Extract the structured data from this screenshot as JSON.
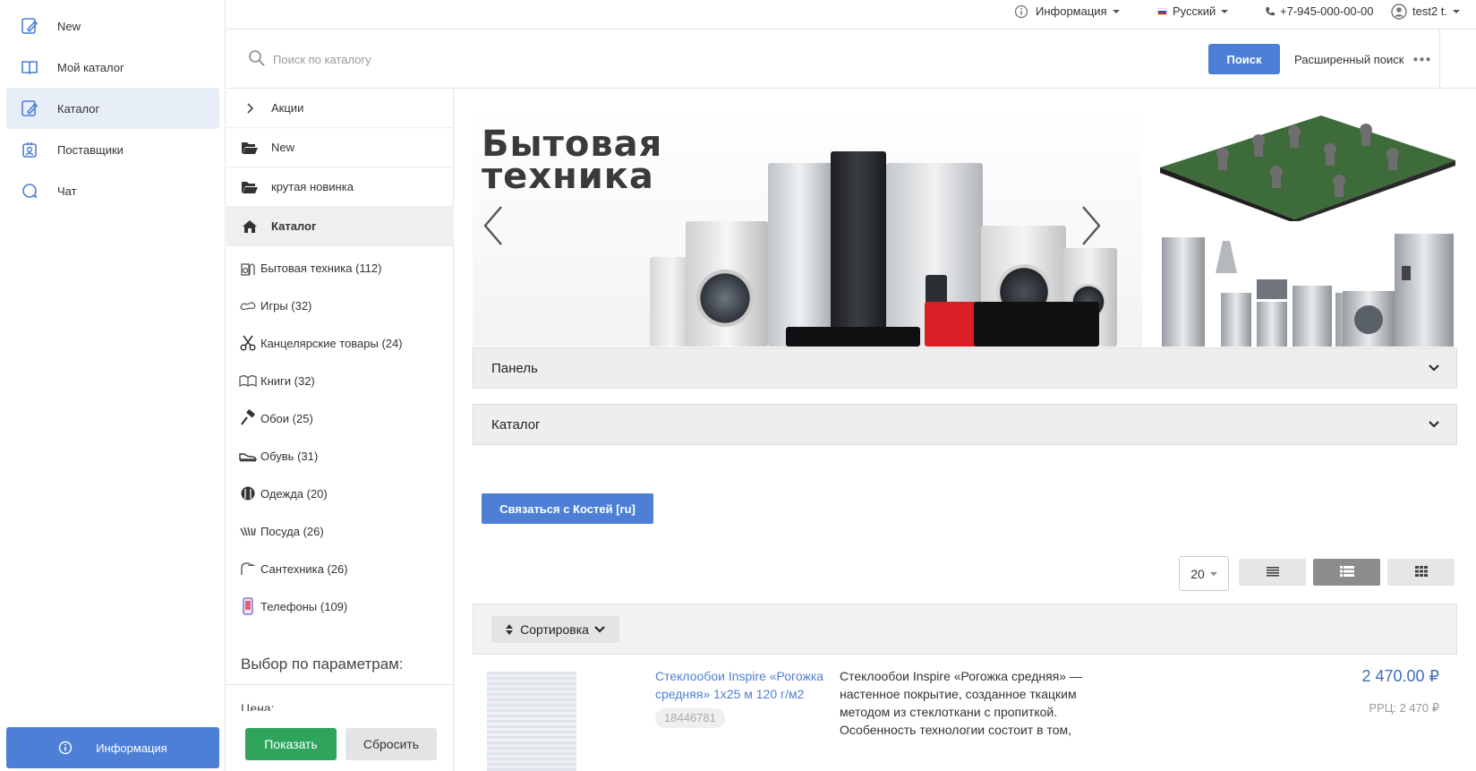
{
  "nav": {
    "items": [
      {
        "label": "New",
        "icon": "catalog-edit-icon"
      },
      {
        "label": "Мой каталог",
        "icon": "book-icon"
      },
      {
        "label": "Каталог",
        "icon": "catalog-edit-icon",
        "active": true
      },
      {
        "label": "Поставщики",
        "icon": "supplier-badge-icon"
      },
      {
        "label": "Чат",
        "icon": "chat-icon"
      }
    ],
    "info_button": "Информация"
  },
  "topbar": {
    "info": "Информация",
    "language": "Русский",
    "phone": "+7-945-000-00-00",
    "user": "test2 t."
  },
  "search": {
    "placeholder": "Поиск по каталогу",
    "button": "Поиск",
    "advanced": "Расширенный поиск"
  },
  "categories": {
    "top_rows": [
      {
        "label": "Акции",
        "icon": "chevron-right-icon"
      },
      {
        "label": "New",
        "icon": "folder-open-icon"
      },
      {
        "label": "крутая новинка",
        "icon": "folder-open-icon"
      },
      {
        "label": "Каталог",
        "icon": "home-icon",
        "active": true
      }
    ],
    "items": [
      {
        "label": "Бытовая техника (112)",
        "icon": "appliance-icon"
      },
      {
        "label": "Игры (32)",
        "icon": "games-icon"
      },
      {
        "label": "Канцелярские товары (24)",
        "icon": "scissors-icon"
      },
      {
        "label": "Книги (32)",
        "icon": "book-open-icon"
      },
      {
        "label": "Обои (25)",
        "icon": "paint-roller-icon"
      },
      {
        "label": "Обувь (31)",
        "icon": "shoe-icon"
      },
      {
        "label": "Одежда (20)",
        "icon": "clothes-icon"
      },
      {
        "label": "Посуда (26)",
        "icon": "dishes-icon"
      },
      {
        "label": "Сантехника (26)",
        "icon": "shower-icon"
      },
      {
        "label": "Телефоны (109)",
        "icon": "phone-icon"
      }
    ],
    "params_title": "Выбор по параметрам:",
    "price_label": "Цена:",
    "show_button": "Показать",
    "reset_button": "Сбросить"
  },
  "banner": {
    "title_line1": "Бытовая",
    "title_line2": "техника"
  },
  "accordions": [
    "Панель",
    "Каталог"
  ],
  "contact_button": "Связаться с Костей [ru]",
  "list_controls": {
    "per_page": "20",
    "sort_label": "Сортировка"
  },
  "product": {
    "title": "Стеклообои Inspire «Рогожка средняя» 1х25 м 120 г/м2",
    "sku": "18446781",
    "description": "Стеклообои Inspire «Рогожка средняя» — настенное покрытие, созданное ткацким методом из стеклоткани с пропиткой. Особенность технологии состоит в том,",
    "price": "2 470.00 ₽",
    "rrp": "РРЦ: 2 470 ₽"
  },
  "colors": {
    "accent": "#4d7fd6",
    "success": "#2ea55a",
    "active_nav": "#e8eef8",
    "price": "#3f6fb7"
  }
}
